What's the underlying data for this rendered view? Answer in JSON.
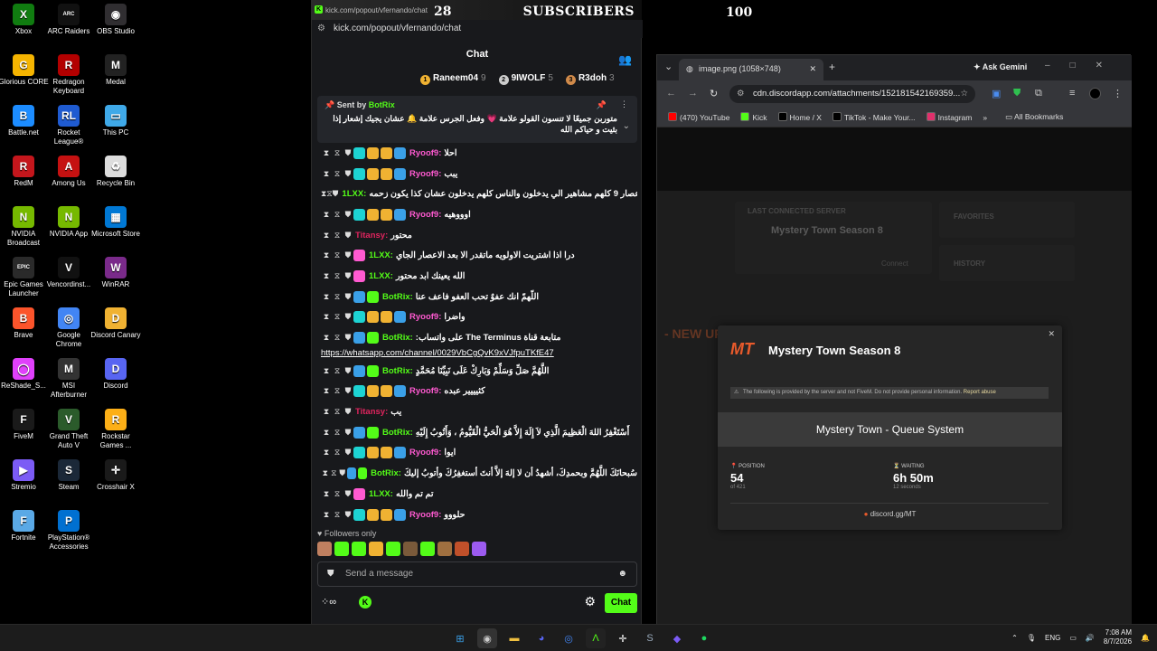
{
  "desktop_icons": [
    {
      "label": "Xbox",
      "color": "#107c10",
      "glyph": "X"
    },
    {
      "label": "ARC Raiders",
      "color": "#111111",
      "glyph": "ARC"
    },
    {
      "label": "OBS Studio",
      "color": "#302e31",
      "glyph": "◉"
    },
    {
      "label": "Glorious CORE",
      "color": "#f5b400",
      "glyph": "G"
    },
    {
      "label": "Redragon Keyboard",
      "color": "#b30000",
      "glyph": "R"
    },
    {
      "label": "Medal",
      "color": "#222222",
      "glyph": "M"
    },
    {
      "label": "Battle.net",
      "color": "#1c8cff",
      "glyph": "B"
    },
    {
      "label": "Rocket League®",
      "color": "#1f5bd1",
      "glyph": "RL"
    },
    {
      "label": "This PC",
      "color": "#3fa9e8",
      "glyph": "▭"
    },
    {
      "label": "RedM",
      "color": "#c4161c",
      "glyph": "R"
    },
    {
      "label": "Among Us",
      "color": "#c51111",
      "glyph": "A"
    },
    {
      "label": "Recycle Bin",
      "color": "#dddddd",
      "glyph": "♻"
    },
    {
      "label": "NVIDIA Broadcast",
      "color": "#76b900",
      "glyph": "N"
    },
    {
      "label": "NVIDIA App",
      "color": "#76b900",
      "glyph": "N"
    },
    {
      "label": "Microsoft Store",
      "color": "#0078d4",
      "glyph": "▦"
    },
    {
      "label": "Epic Games Launcher",
      "color": "#2a2a2a",
      "glyph": "EPIC"
    },
    {
      "label": "Vencordinst...",
      "color": "#111111",
      "glyph": "V"
    },
    {
      "label": "WinRAR",
      "color": "#7a2a8a",
      "glyph": "W"
    },
    {
      "label": "Brave",
      "color": "#fb542b",
      "glyph": "B"
    },
    {
      "label": "Google Chrome",
      "color": "#4285f4",
      "glyph": "◎"
    },
    {
      "label": "Discord Canary",
      "color": "#f0b232",
      "glyph": "D"
    },
    {
      "label": "ReShade_S...",
      "color": "#e040fb",
      "glyph": "◯"
    },
    {
      "label": "MSI Afterburner",
      "color": "#333333",
      "glyph": "M"
    },
    {
      "label": "Discord",
      "color": "#5865f2",
      "glyph": "D"
    },
    {
      "label": "FiveM",
      "color": "#1a1a1a",
      "glyph": "F"
    },
    {
      "label": "Grand Theft Auto V",
      "color": "#2b5b2b",
      "glyph": "V"
    },
    {
      "label": "Rockstar Games ...",
      "color": "#fcaf17",
      "glyph": "R"
    },
    {
      "label": "Stremio",
      "color": "#7b5bf5",
      "glyph": "▶"
    },
    {
      "label": "Steam",
      "color": "#1b2838",
      "glyph": "S"
    },
    {
      "label": "Crosshair X",
      "color": "#1a1a1a",
      "glyph": "✛"
    },
    {
      "label": "Fortnite",
      "color": "#5aa9e6",
      "glyph": "F"
    },
    {
      "label": "PlayStation® Accessories",
      "color": "#0070d1",
      "glyph": "P"
    }
  ],
  "overlay": {
    "subs_count": "28",
    "subs_label": "SUBSCRIBERS",
    "goal": "100"
  },
  "kick": {
    "tab_url": "kick.com/popout/vfernando/chat",
    "address": "kick.com/popout/vfernando/chat",
    "header": "Chat",
    "leaderboard": [
      {
        "name": "Raneem04",
        "count": "9",
        "color": "#f0b232",
        "rank": "1"
      },
      {
        "name": "9IWOLF",
        "count": "5",
        "color": "#cccccc",
        "rank": "2"
      },
      {
        "name": "R3doh",
        "count": "3",
        "color": "#d08a4a",
        "rank": "3"
      }
    ],
    "pinned": {
      "sent_by": "Sent by",
      "bot": "BotRix",
      "message": "متوربن جميعًا لا تنسون القولو علامة 💗 وفعل الجرس علامة 🔔 عشان يجيك إشعار إذا بثيت و حياكم الله"
    },
    "messages": [
      {
        "user": "Ryoof9:",
        "color": "#ff5ad1",
        "text": "احلا",
        "badges": [
          "#1dd3d3",
          "#f0b232",
          "#f0b232",
          "#3aa0e8"
        ]
      },
      {
        "user": "Ryoof9:",
        "color": "#ff5ad1",
        "text": "يبب",
        "badges": [
          "#1dd3d3",
          "#f0b232",
          "#f0b232",
          "#3aa0e8"
        ]
      },
      {
        "user": "1LXX:",
        "color": "#53fc18",
        "text": "اعصار 9 كلهم مشاهير الي يدخلون والناس كلهم يدخلون عشان كذا يكون زحمه",
        "badges": [
          "#ff5ad1"
        ]
      },
      {
        "user": "Ryoof9:",
        "color": "#ff5ad1",
        "text": "اوووهيه",
        "badges": [
          "#1dd3d3",
          "#f0b232",
          "#f0b232",
          "#3aa0e8"
        ]
      },
      {
        "user": "Titansy:",
        "color": "#e0245e",
        "text": "محتور",
        "badges": []
      },
      {
        "user": "1LXX:",
        "color": "#53fc18",
        "text": "درا اذا اشتريت الاولويه ماتقدر الا بعد الاعصار الجاي",
        "badges": [
          "#ff5ad1"
        ]
      },
      {
        "user": "1LXX:",
        "color": "#53fc18",
        "text": "الله يعينك ابد محتور",
        "badges": [
          "#ff5ad1"
        ]
      },
      {
        "user": "BotRix:",
        "color": "#53fc18",
        "text": "اللّهمّ انك عفوٌ تحب العفو فاعف عنا",
        "badges": [
          "#3aa0e8",
          "#53fc18"
        ]
      },
      {
        "user": "Ryoof9:",
        "color": "#ff5ad1",
        "text": "واضرا",
        "badges": [
          "#1dd3d3",
          "#f0b232",
          "#f0b232",
          "#3aa0e8"
        ]
      },
      {
        "user": "BotRix:",
        "color": "#53fc18",
        "text": "متابعة قناة The Terminus على واتساب:",
        "badges": [
          "#3aa0e8",
          "#53fc18"
        ],
        "link": "https://whatsapp.com/channel/0029VbCgQvK9xVJfpuTKfE47"
      },
      {
        "user": "BotRix:",
        "color": "#53fc18",
        "text": "اللَّهُمَّ صَلِّ وَسَلِّمْ وَبَارِكْ عَلَى نَبِيِّنَا مُحَمَّدٍ",
        "badges": [
          "#3aa0e8",
          "#53fc18"
        ]
      },
      {
        "user": "Ryoof9:",
        "color": "#ff5ad1",
        "text": "كثيييير عبده",
        "badges": [
          "#1dd3d3",
          "#f0b232",
          "#f0b232",
          "#3aa0e8"
        ]
      },
      {
        "user": "Titansy:",
        "color": "#e0245e",
        "text": "يب",
        "badges": []
      },
      {
        "user": "BotRix:",
        "color": "#53fc18",
        "text": "أَسْتَغْفِرُ اللهَ الْعَظِيمَ الَّذِي لاَ إِلَهَ إِلاَّ هُوَ الْحَيُّ الْقَيُّومُ ، وَأَتُوبُ إِلَيْهِ",
        "badges": [
          "#3aa0e8",
          "#53fc18"
        ]
      },
      {
        "user": "Ryoof9:",
        "color": "#ff5ad1",
        "text": "ايوا",
        "badges": [
          "#1dd3d3",
          "#f0b232",
          "#f0b232",
          "#3aa0e8"
        ]
      },
      {
        "user": "BotRix:",
        "color": "#53fc18",
        "text": "سُبحانَكَ اللَّهُمَّ وبحمدِكَ، أشهدُ أن لا إلهَ إلاَّ أنتَ أستغفِرُكَ وأتوبُ إليكَ",
        "badges": [
          "#3aa0e8",
          "#53fc18"
        ]
      },
      {
        "user": "1LXX:",
        "color": "#53fc18",
        "text": "تم تم والله",
        "badges": [
          "#ff5ad1"
        ]
      },
      {
        "user": "Ryoof9:",
        "color": "#ff5ad1",
        "text": "حلووو",
        "badges": [
          "#1dd3d3",
          "#f0b232",
          "#f0b232",
          "#3aa0e8"
        ]
      }
    ],
    "followers_label": "Followers only",
    "emote_colors": [
      "#c08060",
      "#53fc18",
      "#53fc18",
      "#f0b232",
      "#53fc18",
      "#7a5a3a",
      "#53fc18",
      "#a07040",
      "#c0502a",
      "#9c5bf0"
    ],
    "input_placeholder": "Send a message",
    "chat_button": "Chat"
  },
  "chrome": {
    "tab_title": "image.png (1058×748)",
    "ask_gemini": "Ask Gemini",
    "url": "cdn.discordapp.com/attachments/152181542169359...",
    "bookmarks": [
      {
        "label": "(470) YouTube",
        "color": "#ff0000"
      },
      {
        "label": "Kick",
        "color": "#53fc18"
      },
      {
        "label": "Home / X",
        "color": "#000000"
      },
      {
        "label": "TikTok - Make Your...",
        "color": "#000000"
      },
      {
        "label": "Instagram",
        "color": "#e1306c"
      }
    ],
    "all_bookmarks": "All Bookmarks",
    "bg": {
      "last_server": "LAST CONNECTED SERVER",
      "server_name": "Mystery Town Season 8",
      "favorites": "FAVORITES",
      "history": "HISTORY",
      "connect": "Connect",
      "new_up": "- NEW UP"
    }
  },
  "modal": {
    "logo": "MT",
    "title": "Mystery Town Season 8",
    "notice": "The following is provided by the server and not FiveM. Do not provide personal information.",
    "report": "Report abuse",
    "queue": "Mystery Town - Queue System",
    "position_label": "POSITION",
    "position": "54",
    "position_of": "of 421",
    "waiting_label": "WAITING",
    "waiting": "6h 50m",
    "waiting_sub": "12 seconds",
    "link": "discord.gg/MT"
  },
  "taskbar": {
    "lang": "ENG",
    "time": "7:08 AM",
    "date": "8/7/2026"
  }
}
